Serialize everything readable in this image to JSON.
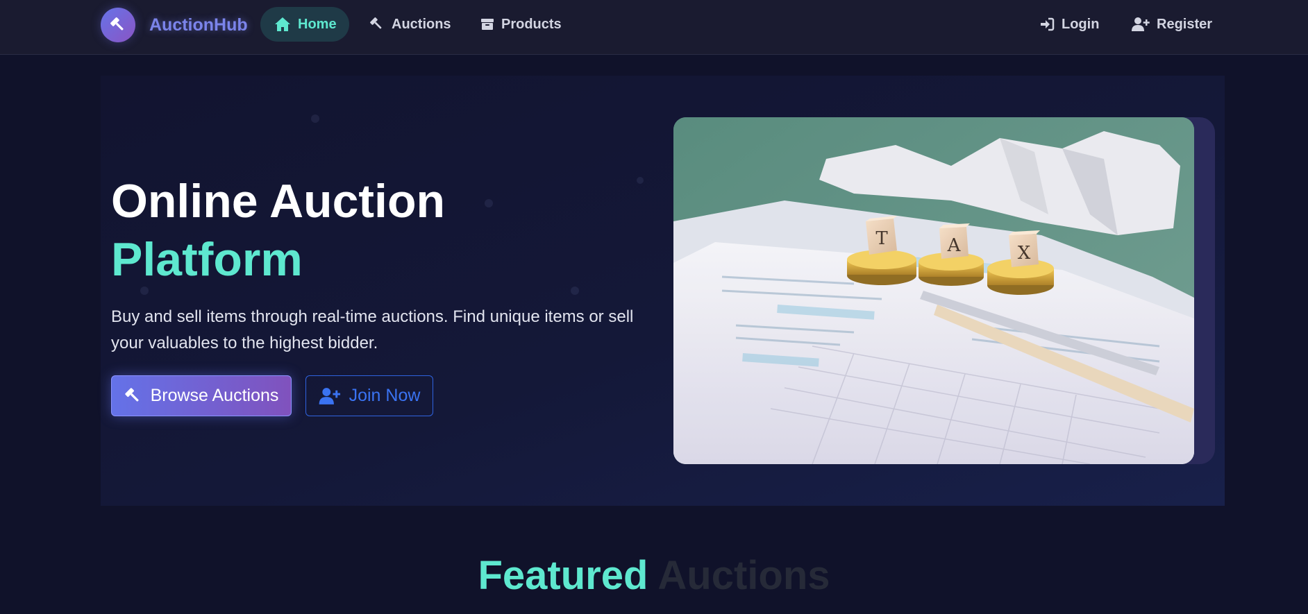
{
  "brand": {
    "name": "AuctionHub"
  },
  "nav": {
    "home": "Home",
    "auctions": "Auctions",
    "products": "Products",
    "login": "Login",
    "register": "Register"
  },
  "hero": {
    "title_line1": "Online Auction",
    "title_line2": "Platform",
    "description": "Buy and sell items through real-time auctions. Find unique items or sell your valuables to the highest bidder.",
    "primary_button": "Browse Auctions",
    "secondary_button": "Join Now",
    "image_blocks": [
      "T",
      "A",
      "X"
    ]
  },
  "featured": {
    "title_part1": "Featured",
    "title_part2": "Auctions"
  },
  "colors": {
    "accent_teal": "#5ee8cf",
    "brand_indigo": "#7b84ea",
    "button_gradient_start": "#6472e8",
    "button_gradient_end": "#8052bd",
    "outline_blue": "#3a73f2",
    "background": "#10122a"
  },
  "icons": {
    "logo": "gavel-icon",
    "home": "home-icon",
    "auctions": "gavel-icon",
    "products": "box-icon",
    "login": "sign-in-icon",
    "register": "user-plus-icon",
    "browse": "gavel-icon",
    "join": "user-plus-icon"
  }
}
